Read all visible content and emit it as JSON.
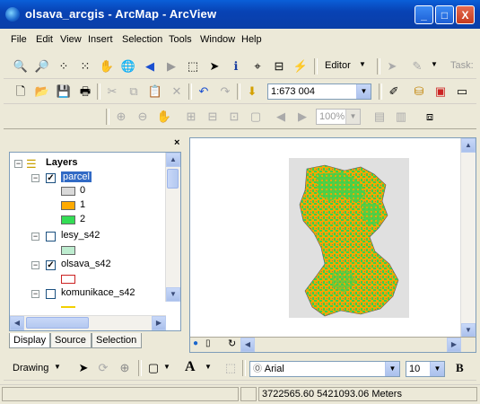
{
  "window": {
    "title": "olsava_arcgis - ArcMap - ArcView",
    "minimize": "_",
    "maximize": "□",
    "close": "X"
  },
  "menubar": [
    "File",
    "Edit",
    "View",
    "Insert",
    "Selection",
    "Tools",
    "Window",
    "Help"
  ],
  "toolbar_tools": {
    "editor_label": "Editor",
    "task_label": "Task:",
    "scale_value": "1:673 004",
    "zoom_value": "100%"
  },
  "toc": {
    "root_label": "Layers",
    "layers": [
      {
        "name": "parcel",
        "checked": true,
        "selected": true,
        "classes": [
          {
            "label": "0",
            "color": "#d9d9d9"
          },
          {
            "label": "1",
            "color": "#ffaa00"
          },
          {
            "label": "2",
            "color": "#33dd55"
          }
        ]
      },
      {
        "name": "lesy_s42",
        "checked": false,
        "symbol_color": "#bdeccf"
      },
      {
        "name": "olsava_s42",
        "checked": true,
        "symbol_color": "#ffffff",
        "symbol_border": "#cc2222"
      },
      {
        "name": "komunikace_s42",
        "checked": false,
        "symbol_color": "#f2d000"
      }
    ],
    "check_mark": "✓",
    "tabs": [
      "Display",
      "Source",
      "Selection"
    ],
    "active_tab": "Display"
  },
  "drawing_toolbar": {
    "drawing_label": "Drawing",
    "font_name": "Arial",
    "font_size": "10",
    "bold_label": "B",
    "text_label": "A"
  },
  "status": {
    "coordinates": "3722565.60  5421093.06 Meters"
  },
  "colors": {
    "titlebar": "#0842b4",
    "map_background": "#e0e0e0",
    "class_0": "#d9d9d9",
    "class_1": "#ffaa00",
    "class_2": "#33dd55"
  }
}
